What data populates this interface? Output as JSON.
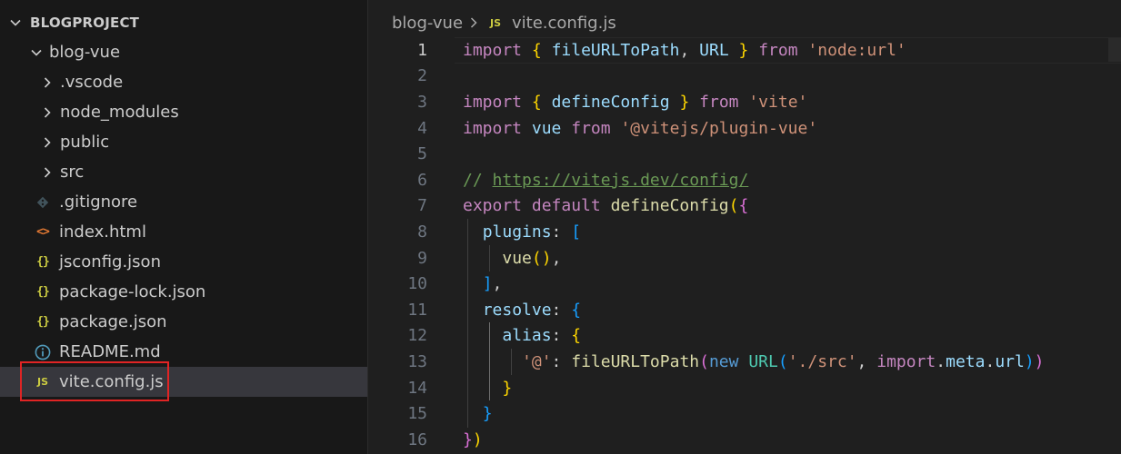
{
  "explorer": {
    "root": "BLOGPROJECT",
    "items": [
      {
        "label": "blog-vue",
        "icon": "chevron-down-icon"
      },
      {
        "label": ".vscode",
        "icon": "chevron-right-icon"
      },
      {
        "label": "node_modules",
        "icon": "chevron-right-icon"
      },
      {
        "label": "public",
        "icon": "chevron-right-icon"
      },
      {
        "label": "src",
        "icon": "chevron-right-icon"
      },
      {
        "label": ".gitignore",
        "icon": "git-file-icon"
      },
      {
        "label": "index.html",
        "icon": "html-file-icon",
        "glyph": "<>"
      },
      {
        "label": "jsconfig.json",
        "icon": "json-file-icon",
        "glyph": "{}"
      },
      {
        "label": "package-lock.json",
        "icon": "json-file-icon",
        "glyph": "{}"
      },
      {
        "label": "package.json",
        "icon": "json-file-icon",
        "glyph": "{}"
      },
      {
        "label": "README.md",
        "icon": "info-file-icon",
        "glyph": "ⓘ"
      },
      {
        "label": "vite.config.js",
        "icon": "js-file-icon",
        "glyph": "JS"
      }
    ]
  },
  "breadcrumb": {
    "folder": "blog-vue",
    "file_icon": "JS",
    "file": "vite.config.js"
  },
  "editor": {
    "line_numbers": [
      "1",
      "2",
      "3",
      "4",
      "5",
      "6",
      "7",
      "8",
      "9",
      "10",
      "11",
      "12",
      "13",
      "14",
      "15",
      "16"
    ],
    "current_line": "1",
    "tokens": {
      "l1_import": "import",
      "l1_ob": "{",
      "l1_fn": "fileURLToPath",
      "l1_comma": ",",
      "l1_url": "URL",
      "l1_cb": "}",
      "l1_from": "from",
      "l1_str": "'node:url'",
      "l3_import": "import",
      "l3_ob": "{",
      "l3_fn": "defineConfig",
      "l3_cb": "}",
      "l3_from": "from",
      "l3_str": "'vite'",
      "l4_import": "import",
      "l4_vue": "vue",
      "l4_from": "from",
      "l4_str": "'@vitejs/plugin-vue'",
      "l6_slashes": "//",
      "l6_url": "https://vitejs.dev/config/",
      "l7_export": "export",
      "l7_default": "default",
      "l7_fn": "defineConfig",
      "l7_op": "(",
      "l7_ob": "{",
      "l8_key": "plugins",
      "l8_colon": ":",
      "l8_ob": "[",
      "l9_fn": "vue",
      "l9_parens": "()",
      "l9_comma": ",",
      "l10_cb": "]",
      "l10_comma": ",",
      "l11_key": "resolve",
      "l11_colon": ":",
      "l11_ob": "{",
      "l12_key": "alias",
      "l12_colon": ":",
      "l12_ob": "{",
      "l13_key": "'@'",
      "l13_colon": ":",
      "l13_fn": "fileURLToPath",
      "l13_op": "(",
      "l13_new": "new",
      "l13_cls": "URL",
      "l13_op2": "(",
      "l13_str": "'./src'",
      "l13_comma": ",",
      "l13_import": "import",
      "l13_dot1": ".",
      "l13_meta": "meta",
      "l13_dot2": ".",
      "l13_urlprop": "url",
      "l13_cp2": ")",
      "l13_cp": ")",
      "l14_cb": "}",
      "l15_cb": "}",
      "l16_cb": "}",
      "l16_cp": ")"
    }
  }
}
